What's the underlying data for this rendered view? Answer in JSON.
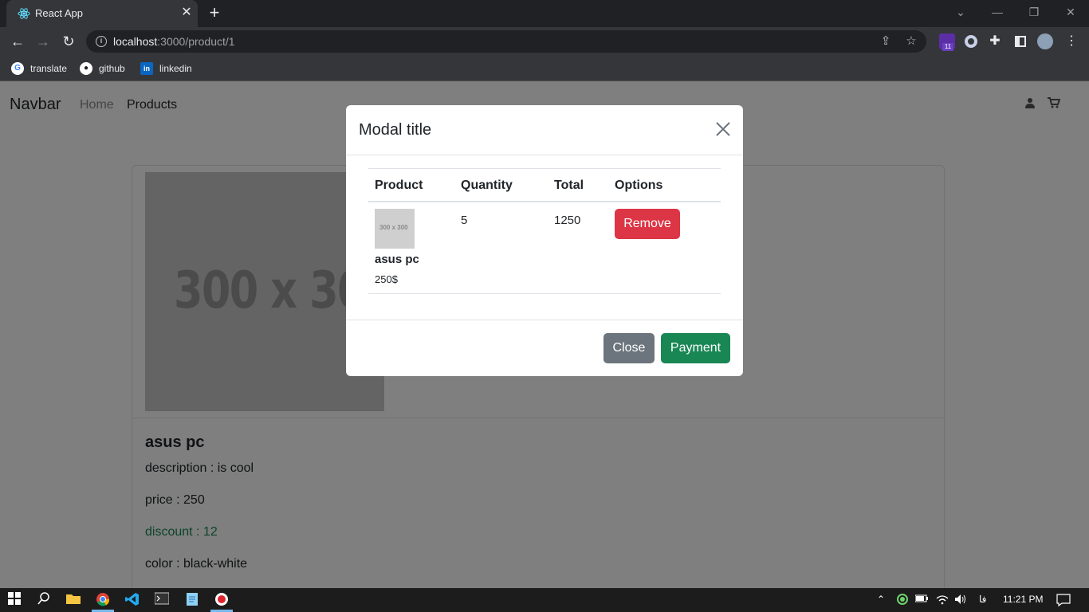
{
  "browser": {
    "tab_title": "React App",
    "tab_close": "✕",
    "new_tab": "+",
    "url_host": "localhost",
    "url_rest": ":3000/product/1",
    "extension_badge": "11",
    "bookmarks": [
      {
        "label": "translate",
        "icon": "google-icon"
      },
      {
        "label": "github",
        "icon": "github-icon"
      },
      {
        "label": "linkedin",
        "icon": "linkedin-icon"
      }
    ]
  },
  "navbar": {
    "brand": "Navbar",
    "links": [
      "Home",
      "Products"
    ]
  },
  "product": {
    "image_placeholder": "300 x 300",
    "name": "asus pc",
    "description": "description : is cool",
    "price": "price : 250",
    "discount": "discount : 12",
    "color": "color : black-white"
  },
  "modal": {
    "title": "Modal title",
    "close_icon": "✕",
    "columns": [
      "Product",
      "Quantity",
      "Total",
      "Options"
    ],
    "rows": [
      {
        "thumb": "300 x 300",
        "name": "asus pc",
        "price": "250$",
        "quantity": "5",
        "total": "1250",
        "action": "Remove"
      }
    ],
    "footer": {
      "close_label": "Close",
      "payment_label": "Payment"
    }
  },
  "taskbar": {
    "time": "11:21 PM",
    "lang": "فا"
  },
  "colors": {
    "danger": "#dc3545",
    "secondary": "#6c757d",
    "success": "#198754",
    "discount_text": "#198754"
  }
}
